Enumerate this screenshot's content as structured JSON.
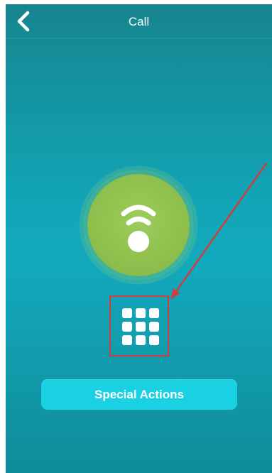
{
  "header": {
    "title": "Call"
  },
  "actions": {
    "special_label": "Special Actions"
  },
  "icons": {
    "back": "chevron-left-icon",
    "call": "wifi-call-icon",
    "keypad": "keypad-icon"
  },
  "colors": {
    "background_top": "#16858f",
    "background_mid": "#11a5b6",
    "accent_button": "#1ad1e4",
    "call_green": "#8fbf4d",
    "annotation_red": "#d13d3d"
  }
}
